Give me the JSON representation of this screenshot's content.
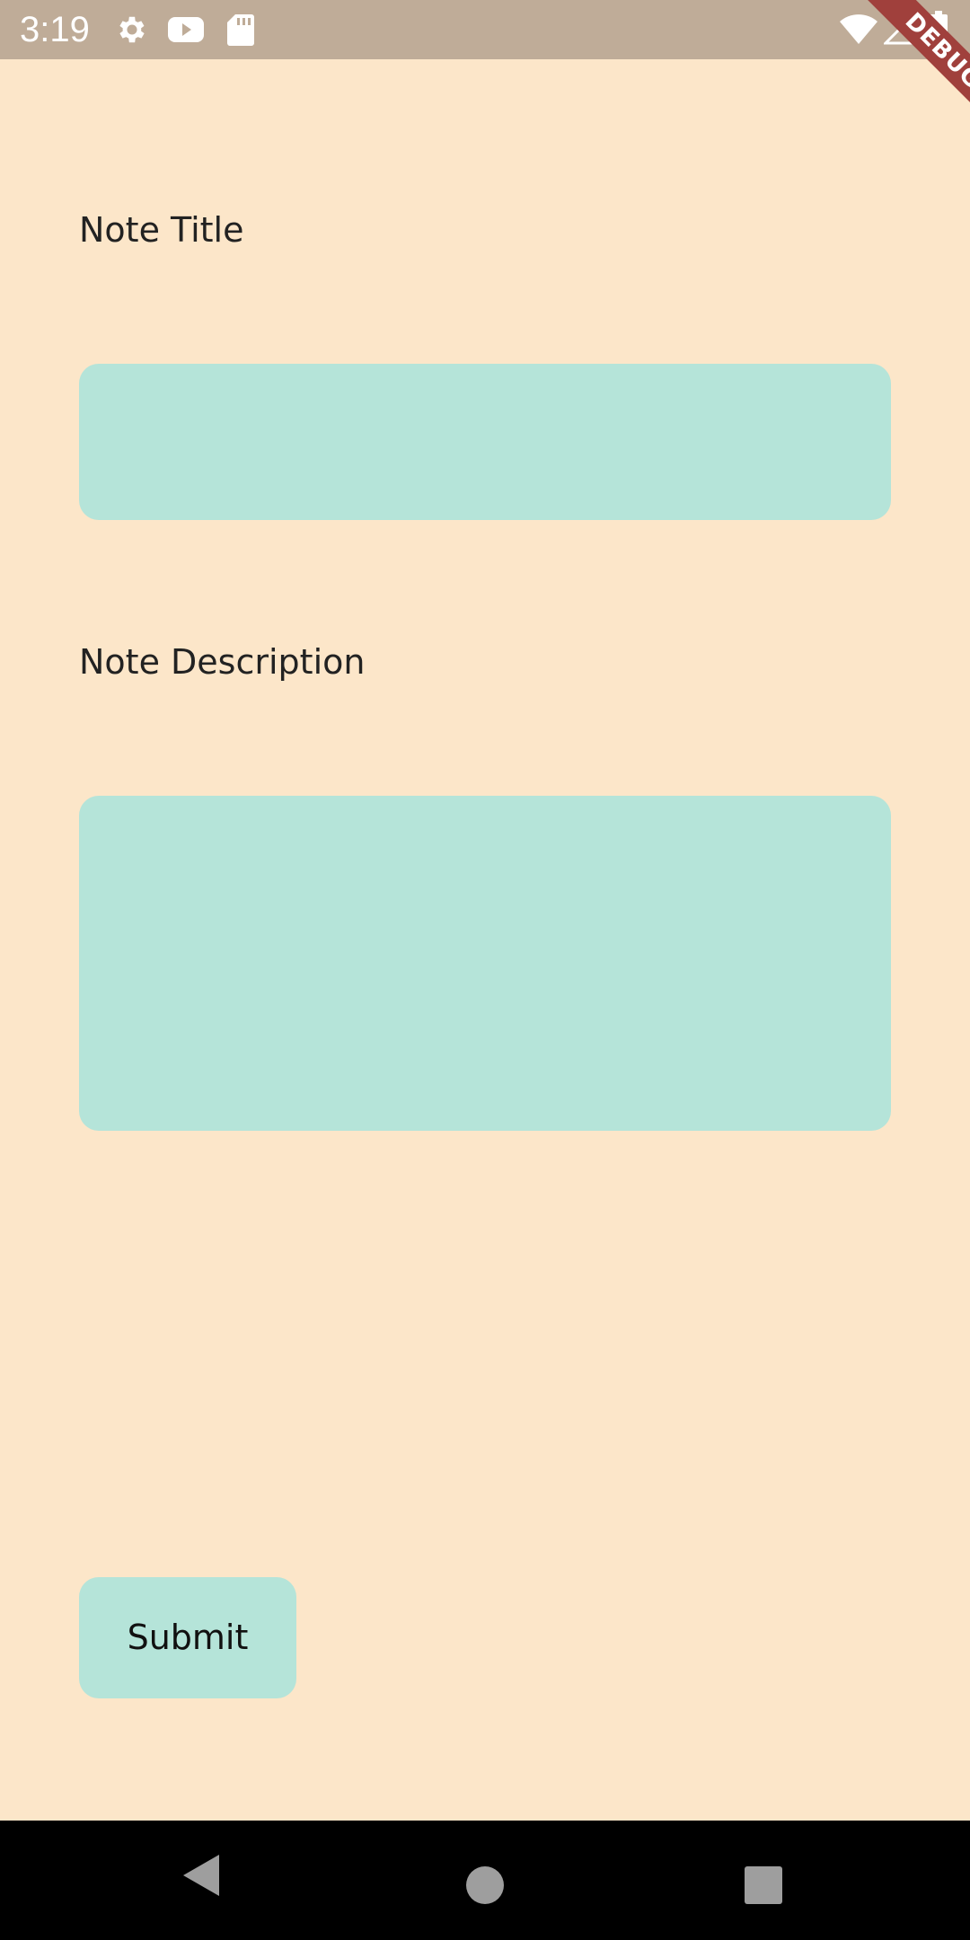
{
  "status_bar": {
    "time": "3:19",
    "background": "#bfac98",
    "icons": [
      "gear-icon",
      "youtube-icon",
      "sd-card-icon",
      "wifi-icon",
      "signal-icon",
      "battery-icon"
    ]
  },
  "debug_banner": {
    "label": "DEBUG",
    "color": "#a0403c"
  },
  "form": {
    "title_label": "Note Title",
    "title_value": "",
    "description_label": "Note Description",
    "description_value": "",
    "submit_label": "Submit"
  },
  "theme": {
    "background": "#fce6c9",
    "field_color": "#b5e4d9"
  },
  "nav_bar": {
    "icons": [
      "back-icon",
      "home-icon",
      "recents-icon"
    ]
  }
}
